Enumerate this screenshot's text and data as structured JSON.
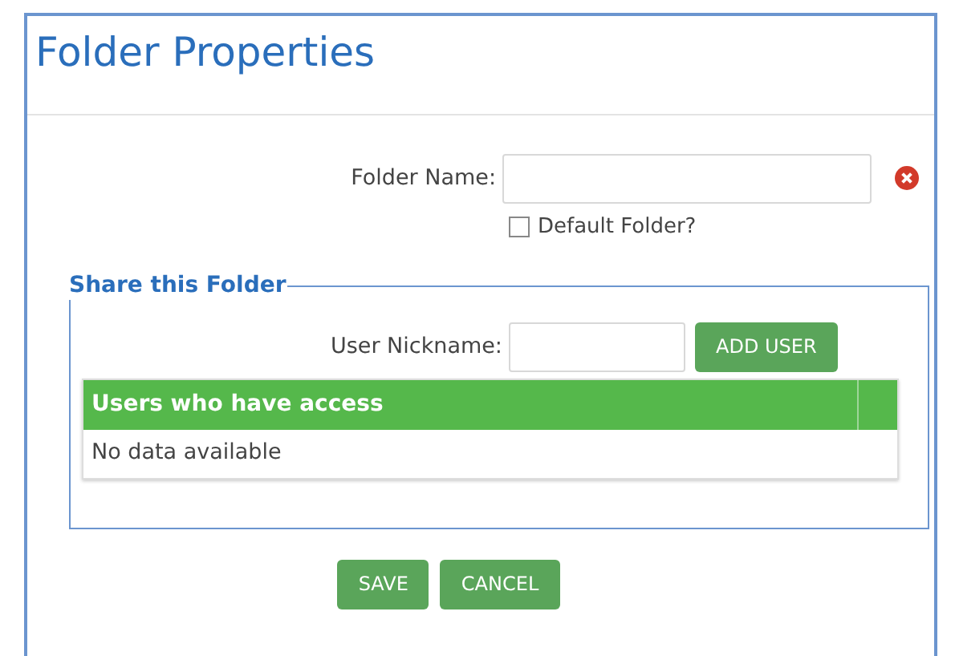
{
  "dialog": {
    "title": "Folder Properties"
  },
  "folder_name": {
    "label": "Folder Name:",
    "error": true
  },
  "default_folder": {
    "label": "Default Folder?",
    "checked": false
  },
  "share": {
    "legend": "Share this Folder",
    "nickname": {
      "label": "User Nickname:"
    },
    "add_button": "ADD USER",
    "table": {
      "columns": [
        "Users who have access"
      ],
      "empty_text": "No data available"
    }
  },
  "buttons": [
    {
      "label": "SAVE"
    },
    {
      "label": "CANCEL"
    }
  ]
}
